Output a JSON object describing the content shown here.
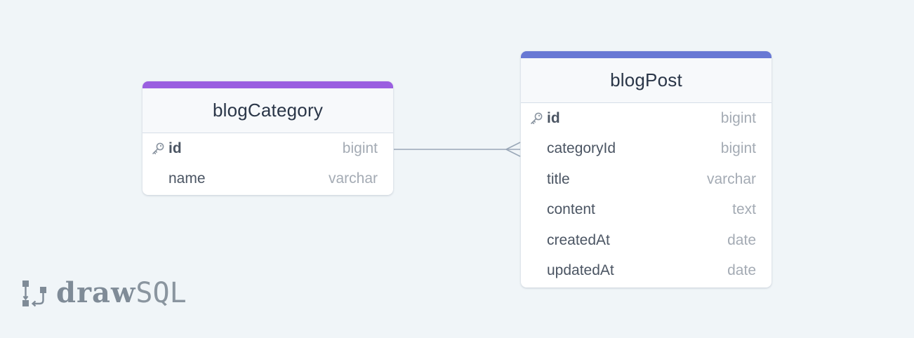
{
  "colors": {
    "background": "#f0f5f8",
    "blogCategory_accent": "#9a5fe0",
    "blogPost_accent": "#6879d4",
    "relation_line": "#9aa7b8"
  },
  "tables": {
    "blogCategory": {
      "title": "blogCategory",
      "columns": [
        {
          "name": "id",
          "type": "bigint",
          "primary_key": true
        },
        {
          "name": "name",
          "type": "varchar",
          "primary_key": false
        }
      ]
    },
    "blogPost": {
      "title": "blogPost",
      "columns": [
        {
          "name": "id",
          "type": "bigint",
          "primary_key": true
        },
        {
          "name": "categoryId",
          "type": "bigint",
          "primary_key": false
        },
        {
          "name": "title",
          "type": "varchar",
          "primary_key": false
        },
        {
          "name": "content",
          "type": "text",
          "primary_key": false
        },
        {
          "name": "createdAt",
          "type": "date",
          "primary_key": false
        },
        {
          "name": "updatedAt",
          "type": "date",
          "primary_key": false
        }
      ]
    }
  },
  "relations": [
    {
      "from": "blogCategory.id",
      "to": "blogPost.categoryId",
      "cardinality": "one-to-many"
    }
  ],
  "icons": {
    "primary_key": "key-icon",
    "logo": "drawsql-logo-icon"
  },
  "branding": {
    "logo_part1": "draw",
    "logo_part2": "SQL"
  }
}
